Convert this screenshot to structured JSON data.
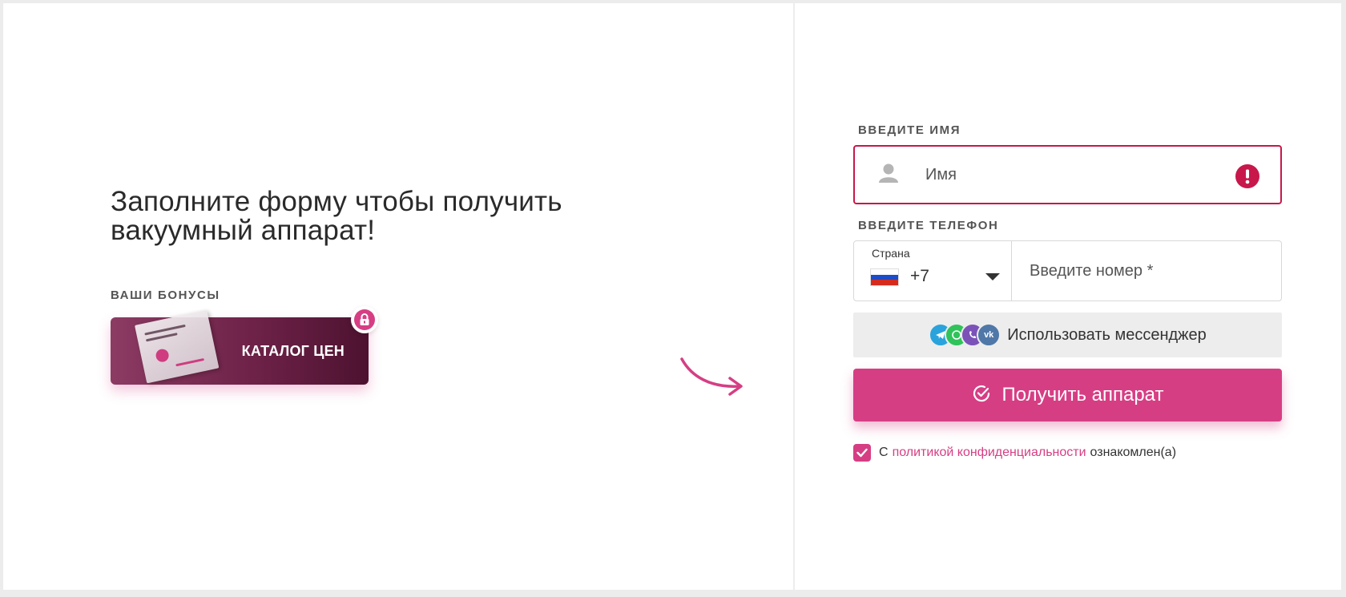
{
  "left": {
    "headline": "Заполните форму чтобы получить вакуумный аппарат!",
    "bonuses_label": "ВАШИ БОНУСЫ",
    "bonus_card": {
      "title": "КАТАЛОГ ЦЕН",
      "locked": true
    }
  },
  "form": {
    "name": {
      "label": "ВВЕДИТЕ ИМЯ",
      "placeholder": "Имя",
      "value": "",
      "error": true
    },
    "phone": {
      "label": "ВВЕДИТЕ ТЕЛЕФОН",
      "country_caption": "Страна",
      "country_code": "+7",
      "placeholder": "Введите номер *",
      "value": ""
    },
    "messenger_button": "Использовать мессенджер",
    "messenger_icons": [
      "telegram-icon",
      "whatsapp-icon",
      "viber-icon",
      "vk-icon"
    ],
    "submit_button": "Получить аппарат",
    "consent": {
      "checked": true,
      "prefix": "С",
      "link": "политикой конфиденциальности",
      "suffix": "ознакомлен(а)"
    }
  },
  "colors": {
    "accent": "#d63e84",
    "error": "#c8174a",
    "card_dark": "#5a1a3a",
    "telegram": "#2aa3dc",
    "whatsapp": "#2fc35a",
    "viber": "#7b53b8",
    "vk": "#4f78a8"
  }
}
